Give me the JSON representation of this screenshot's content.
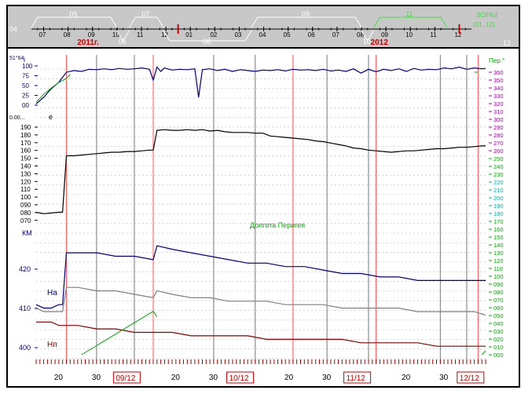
{
  "timeline": {
    "year_labels": [
      {
        "text": "2011г.",
        "at": 2
      },
      {
        "text": "2012",
        "at": 14
      }
    ],
    "month_ticks": [
      "07",
      "08",
      "09",
      "10",
      "11",
      "12",
      "01",
      "02",
      "03",
      "04",
      "05",
      "06",
      "07",
      "08",
      "09",
      "10",
      "11",
      "12"
    ],
    "side_labels": {
      "left": "04",
      "right": "12"
    },
    "bracket_labels": [
      {
        "text": "05",
        "start": 0,
        "end": 3.5,
        "color": "#ffffff"
      },
      {
        "text": "06",
        "start": 3.5,
        "end": 4.0,
        "color": "#ffffff",
        "below": true
      },
      {
        "text": "07",
        "start": 4.0,
        "end": 5.4,
        "color": "#ffffff"
      },
      {
        "text": "08",
        "start": 5.4,
        "end": 9.0,
        "color": "#ffffff",
        "below": true
      },
      {
        "text": "09",
        "start": 9.0,
        "end": 13.5,
        "color": "#ffffff"
      },
      {
        "text": "10",
        "start": 13.5,
        "end": 14.0,
        "color": "#ffffff",
        "below": true
      },
      {
        "text": "11",
        "start": 14.0,
        "end": 17.0,
        "color": "#44dd44"
      }
    ],
    "zone_label": "ЗОНЫ",
    "zone_range": "(01..12)",
    "marker_positions": [
      6.0,
      17.5
    ]
  },
  "panels": {
    "incl": {
      "label": "i",
      "top_label": "51°64",
      "ticks": [
        "100",
        "75",
        "50",
        "25",
        "00"
      ]
    },
    "ecc": {
      "label": "e",
      "top_label": "0.00...",
      "ticks": [
        "190",
        "180",
        "170",
        "160",
        "150",
        "140",
        "130",
        "120",
        "110",
        "100",
        "090",
        "080",
        "070"
      ]
    },
    "alt": {
      "unit": "КМ",
      "ticks": [
        "420",
        "410",
        "400"
      ],
      "ha_label": "На",
      "hp_label": "Нп"
    }
  },
  "right_axis": {
    "title": "Пер.°",
    "ticks": [
      "360",
      "350",
      "340",
      "330",
      "320",
      "310",
      "300",
      "290",
      "280",
      "270",
      "260",
      "250",
      "240",
      "230",
      "220",
      "210",
      "200",
      "190",
      "180",
      "170",
      "160",
      "150",
      "140",
      "130",
      "120",
      "110",
      "100",
      "090",
      "080",
      "070",
      "060",
      "050",
      "040",
      "030",
      "020",
      "010",
      "000"
    ]
  },
  "annotation": "Долгота Перигея",
  "x_axis": {
    "day_labels": [
      {
        "text": "20",
        "day": 20
      },
      {
        "text": "30",
        "day": 30
      },
      {
        "text": "20",
        "day": 51
      },
      {
        "text": "30",
        "day": 61
      },
      {
        "text": "20",
        "day": 81
      },
      {
        "text": "30",
        "day": 91
      },
      {
        "text": "20",
        "day": 112
      },
      {
        "text": "30",
        "day": 122
      }
    ],
    "month_boxes": [
      {
        "text": "09/12",
        "day": 38
      },
      {
        "text": "10/12",
        "day": 68
      },
      {
        "text": "11/12",
        "day": 99
      },
      {
        "text": "12/12",
        "day": 129
      }
    ]
  },
  "chart_data": {
    "type": "line",
    "x_unit": "day",
    "x_range": [
      14,
      133
    ],
    "series": [
      {
        "name": "i",
        "color": "#00008b",
        "panel": "incl",
        "ylim": [
          0,
          100
        ],
        "points": [
          [
            14,
            5
          ],
          [
            16,
            20
          ],
          [
            18,
            40
          ],
          [
            20,
            55
          ],
          [
            22,
            78
          ],
          [
            24,
            82
          ],
          [
            26,
            80
          ],
          [
            28,
            85
          ],
          [
            30,
            84
          ],
          [
            32,
            86
          ],
          [
            34,
            84
          ],
          [
            36,
            87
          ],
          [
            38,
            85
          ],
          [
            40,
            86
          ],
          [
            42,
            88
          ],
          [
            44,
            85
          ],
          [
            45,
            60
          ],
          [
            46,
            90
          ],
          [
            47,
            80
          ],
          [
            48,
            88
          ],
          [
            50,
            83
          ],
          [
            52,
            85
          ],
          [
            54,
            84
          ],
          [
            56,
            86
          ],
          [
            57,
            20
          ],
          [
            58,
            84
          ],
          [
            60,
            86
          ],
          [
            62,
            82
          ],
          [
            64,
            85
          ],
          [
            66,
            80
          ],
          [
            68,
            84
          ],
          [
            70,
            82
          ],
          [
            72,
            80
          ],
          [
            74,
            83
          ],
          [
            76,
            82
          ],
          [
            78,
            84
          ],
          [
            80,
            81
          ],
          [
            82,
            85
          ],
          [
            84,
            83
          ],
          [
            86,
            84
          ],
          [
            88,
            82
          ],
          [
            90,
            85
          ],
          [
            92,
            81
          ],
          [
            94,
            83
          ],
          [
            96,
            80
          ],
          [
            98,
            86
          ],
          [
            100,
            76
          ],
          [
            102,
            85
          ],
          [
            104,
            79
          ],
          [
            106,
            85
          ],
          [
            108,
            82
          ],
          [
            110,
            86
          ],
          [
            112,
            80
          ],
          [
            114,
            87
          ],
          [
            116,
            83
          ],
          [
            118,
            85
          ],
          [
            120,
            84
          ],
          [
            122,
            88
          ],
          [
            124,
            86
          ],
          [
            126,
            90
          ],
          [
            128,
            85
          ],
          [
            130,
            88
          ],
          [
            132,
            86
          ],
          [
            133,
            87
          ]
        ]
      },
      {
        "name": "e",
        "color": "#000000",
        "panel": "ecc",
        "ylim": [
          65,
          195
        ],
        "points": [
          [
            14,
            70
          ],
          [
            16,
            68
          ],
          [
            18,
            69
          ],
          [
            20,
            70
          ],
          [
            21,
            70
          ],
          [
            22,
            150
          ],
          [
            24,
            150
          ],
          [
            26,
            151
          ],
          [
            28,
            152
          ],
          [
            30,
            153
          ],
          [
            32,
            154
          ],
          [
            34,
            155
          ],
          [
            36,
            155
          ],
          [
            38,
            156
          ],
          [
            40,
            156
          ],
          [
            42,
            157
          ],
          [
            44,
            158
          ],
          [
            45,
            158
          ],
          [
            46,
            186
          ],
          [
            48,
            187
          ],
          [
            50,
            186
          ],
          [
            52,
            186
          ],
          [
            54,
            187
          ],
          [
            56,
            186
          ],
          [
            58,
            187
          ],
          [
            60,
            185
          ],
          [
            62,
            186
          ],
          [
            64,
            184
          ],
          [
            66,
            183
          ],
          [
            68,
            183
          ],
          [
            70,
            183
          ],
          [
            72,
            182
          ],
          [
            74,
            182
          ],
          [
            76,
            178
          ],
          [
            78,
            177
          ],
          [
            80,
            176
          ],
          [
            82,
            175
          ],
          [
            84,
            174
          ],
          [
            86,
            173
          ],
          [
            88,
            171
          ],
          [
            90,
            170
          ],
          [
            92,
            168
          ],
          [
            94,
            166
          ],
          [
            96,
            164
          ],
          [
            98,
            161
          ],
          [
            100,
            160
          ],
          [
            102,
            158
          ],
          [
            104,
            157
          ],
          [
            106,
            156
          ],
          [
            108,
            155
          ],
          [
            110,
            156
          ],
          [
            112,
            157
          ],
          [
            114,
            157
          ],
          [
            116,
            158
          ],
          [
            118,
            159
          ],
          [
            120,
            160
          ],
          [
            122,
            160
          ],
          [
            124,
            161
          ],
          [
            126,
            162
          ],
          [
            128,
            162
          ],
          [
            130,
            163
          ],
          [
            132,
            164
          ],
          [
            133,
            164
          ]
        ]
      },
      {
        "name": "Ha",
        "color": "#00008b",
        "panel": "alt",
        "ylim": [
          398,
          432
        ],
        "points": [
          [
            14,
            412
          ],
          [
            16,
            411
          ],
          [
            18,
            411
          ],
          [
            20,
            412
          ],
          [
            21,
            412
          ],
          [
            22,
            427
          ],
          [
            25,
            427
          ],
          [
            30,
            427
          ],
          [
            35,
            426
          ],
          [
            40,
            426
          ],
          [
            45,
            425
          ],
          [
            46,
            429
          ],
          [
            50,
            428
          ],
          [
            55,
            427
          ],
          [
            60,
            426
          ],
          [
            65,
            425
          ],
          [
            70,
            424
          ],
          [
            75,
            424
          ],
          [
            80,
            423
          ],
          [
            85,
            423
          ],
          [
            90,
            422
          ],
          [
            95,
            421
          ],
          [
            100,
            421
          ],
          [
            105,
            420
          ],
          [
            110,
            420
          ],
          [
            115,
            419
          ],
          [
            120,
            419
          ],
          [
            125,
            419
          ],
          [
            130,
            419
          ],
          [
            133,
            419
          ]
        ]
      },
      {
        "name": "Hm",
        "color": "#808080",
        "panel": "alt",
        "ylim": [
          398,
          432
        ],
        "points": [
          [
            14,
            411
          ],
          [
            16,
            410
          ],
          [
            18,
            410
          ],
          [
            20,
            410
          ],
          [
            21,
            410
          ],
          [
            22,
            417
          ],
          [
            25,
            417
          ],
          [
            30,
            416
          ],
          [
            35,
            416
          ],
          [
            40,
            415
          ],
          [
            45,
            414
          ],
          [
            46,
            416
          ],
          [
            50,
            415
          ],
          [
            55,
            414
          ],
          [
            60,
            414
          ],
          [
            65,
            413
          ],
          [
            70,
            413
          ],
          [
            75,
            413
          ],
          [
            80,
            412
          ],
          [
            85,
            412
          ],
          [
            90,
            412
          ],
          [
            95,
            411
          ],
          [
            100,
            411
          ],
          [
            105,
            411
          ],
          [
            110,
            411
          ],
          [
            115,
            410
          ],
          [
            120,
            410
          ],
          [
            125,
            410
          ],
          [
            130,
            410
          ],
          [
            133,
            409
          ]
        ]
      },
      {
        "name": "Hp",
        "color": "#8b0000",
        "panel": "alt",
        "ylim": [
          398,
          432
        ],
        "points": [
          [
            14,
            407
          ],
          [
            16,
            407
          ],
          [
            18,
            407
          ],
          [
            20,
            406
          ],
          [
            21,
            406
          ],
          [
            22,
            406
          ],
          [
            25,
            406
          ],
          [
            30,
            405
          ],
          [
            35,
            405
          ],
          [
            40,
            404
          ],
          [
            45,
            404
          ],
          [
            46,
            404
          ],
          [
            50,
            404
          ],
          [
            55,
            403
          ],
          [
            60,
            403
          ],
          [
            65,
            403
          ],
          [
            70,
            403
          ],
          [
            75,
            402
          ],
          [
            80,
            402
          ],
          [
            85,
            402
          ],
          [
            90,
            402
          ],
          [
            95,
            402
          ],
          [
            100,
            401
          ],
          [
            105,
            401
          ],
          [
            110,
            401
          ],
          [
            115,
            401
          ],
          [
            120,
            400
          ],
          [
            125,
            400
          ],
          [
            130,
            400
          ],
          [
            133,
            400
          ]
        ]
      },
      {
        "name": "perigee",
        "color": "#00aa00",
        "panel": "right",
        "ylim": [
          0,
          360
        ],
        "points": [
          [
            14,
            320
          ],
          [
            16,
            330
          ],
          [
            18,
            338
          ],
          [
            20,
            345
          ],
          [
            22,
            350
          ],
          [
            23,
            355
          ],
          [
            26,
            0
          ],
          [
            45,
            55
          ],
          [
            46,
            48
          ],
          [
            130,
            358
          ],
          [
            131,
            358
          ],
          [
            132,
            0
          ],
          [
            133,
            5
          ]
        ]
      }
    ],
    "event_lines": {
      "red": [
        22,
        45,
        82,
        104,
        131
      ],
      "gray": [
        30,
        40,
        61,
        72,
        91,
        102,
        121,
        128
      ]
    }
  }
}
